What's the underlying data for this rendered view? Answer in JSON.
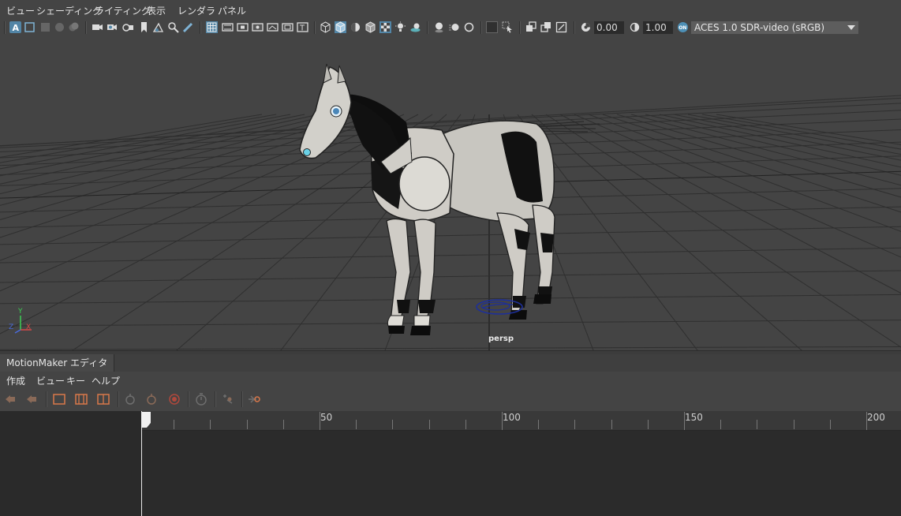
{
  "menu": [
    "ビュー",
    "シェーディング",
    "ライティング",
    "表示",
    "レンダラ",
    "パネル"
  ],
  "toolbar": {
    "exposure_value": "0.00",
    "gamma_value": "1.00",
    "color_space": "ACES 1.0 SDR-video (sRGB)",
    "icons": [
      "select-camera-icon",
      "camera-attributes-icon",
      "bookmark-icon",
      "image-plane-icon",
      "grid-icon",
      "film-gate-icon",
      "resolution-gate-icon",
      "wireframe-icon",
      "smooth-shade-icon",
      "textured-icon",
      "lighting-icon",
      "shadows-icon",
      "xray-icon",
      "isolate-icon",
      "exposure-icon",
      "gamma-icon",
      "color-management-icon"
    ]
  },
  "viewport": {
    "camera_label": "persp",
    "axis": {
      "x": "X",
      "y": "Y",
      "z": "Z"
    }
  },
  "editor": {
    "title": "MotionMaker エディタ",
    "menu": [
      "作成",
      "ビュー",
      "キー",
      "ヘルプ"
    ],
    "ruler_labels": [
      "50",
      "100",
      "150",
      "200"
    ]
  },
  "colors": {
    "accent": "#5285a6",
    "panel_bg": "#444444",
    "timeline_bg": "#2b2b2b"
  }
}
